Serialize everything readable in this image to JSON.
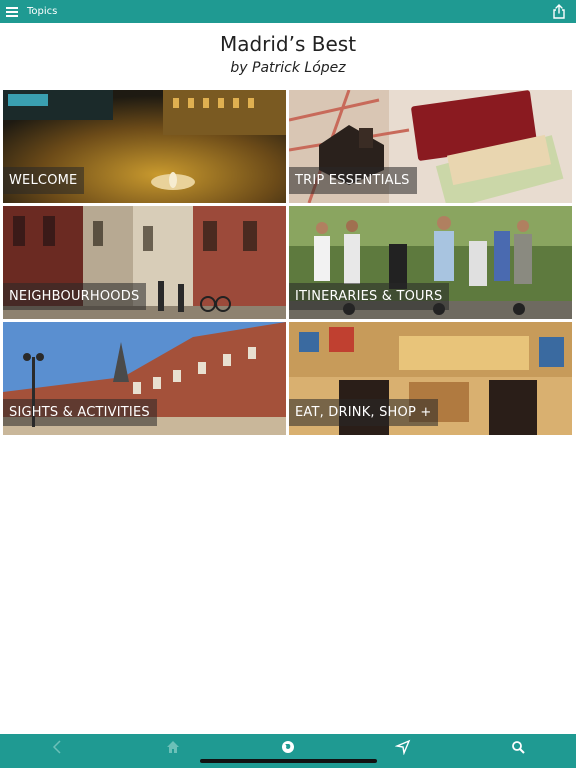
{
  "topbar": {
    "title": "Topics",
    "menu_icon": "hamburger-menu-icon",
    "share_icon": "share-icon"
  },
  "header": {
    "title": "Madrid’s Best",
    "author": "by Patrick López"
  },
  "topics": [
    {
      "label": "WELCOME",
      "photo": "puerta-del-sol-night-square"
    },
    {
      "label": "TRIP ESSENTIALS",
      "photo": "passport-plug-adapter-map"
    },
    {
      "label": "NEIGHBOURHOODS",
      "photo": "narrow-street-balconies"
    },
    {
      "label": "ITINERARIES & TOURS",
      "photo": "segway-tour-group"
    },
    {
      "label": "SIGHTS & ACTIVITIES",
      "photo": "plaza-mayor-arcades"
    },
    {
      "label": "EAT, DRINK, SHOP +",
      "photo": "la-chata-tiled-bar-facade"
    }
  ],
  "bottom_tabs": [
    {
      "icon": "back-arrow-icon",
      "state": "disabled"
    },
    {
      "icon": "home-icon",
      "state": "inactive"
    },
    {
      "icon": "globe-icon",
      "state": "active"
    },
    {
      "icon": "location-arrow-icon",
      "state": "inactive"
    },
    {
      "icon": "search-icon",
      "state": "inactive"
    }
  ],
  "colors": {
    "accent": "#1f9a92",
    "label_bg": "#333333",
    "text": "#222222"
  }
}
